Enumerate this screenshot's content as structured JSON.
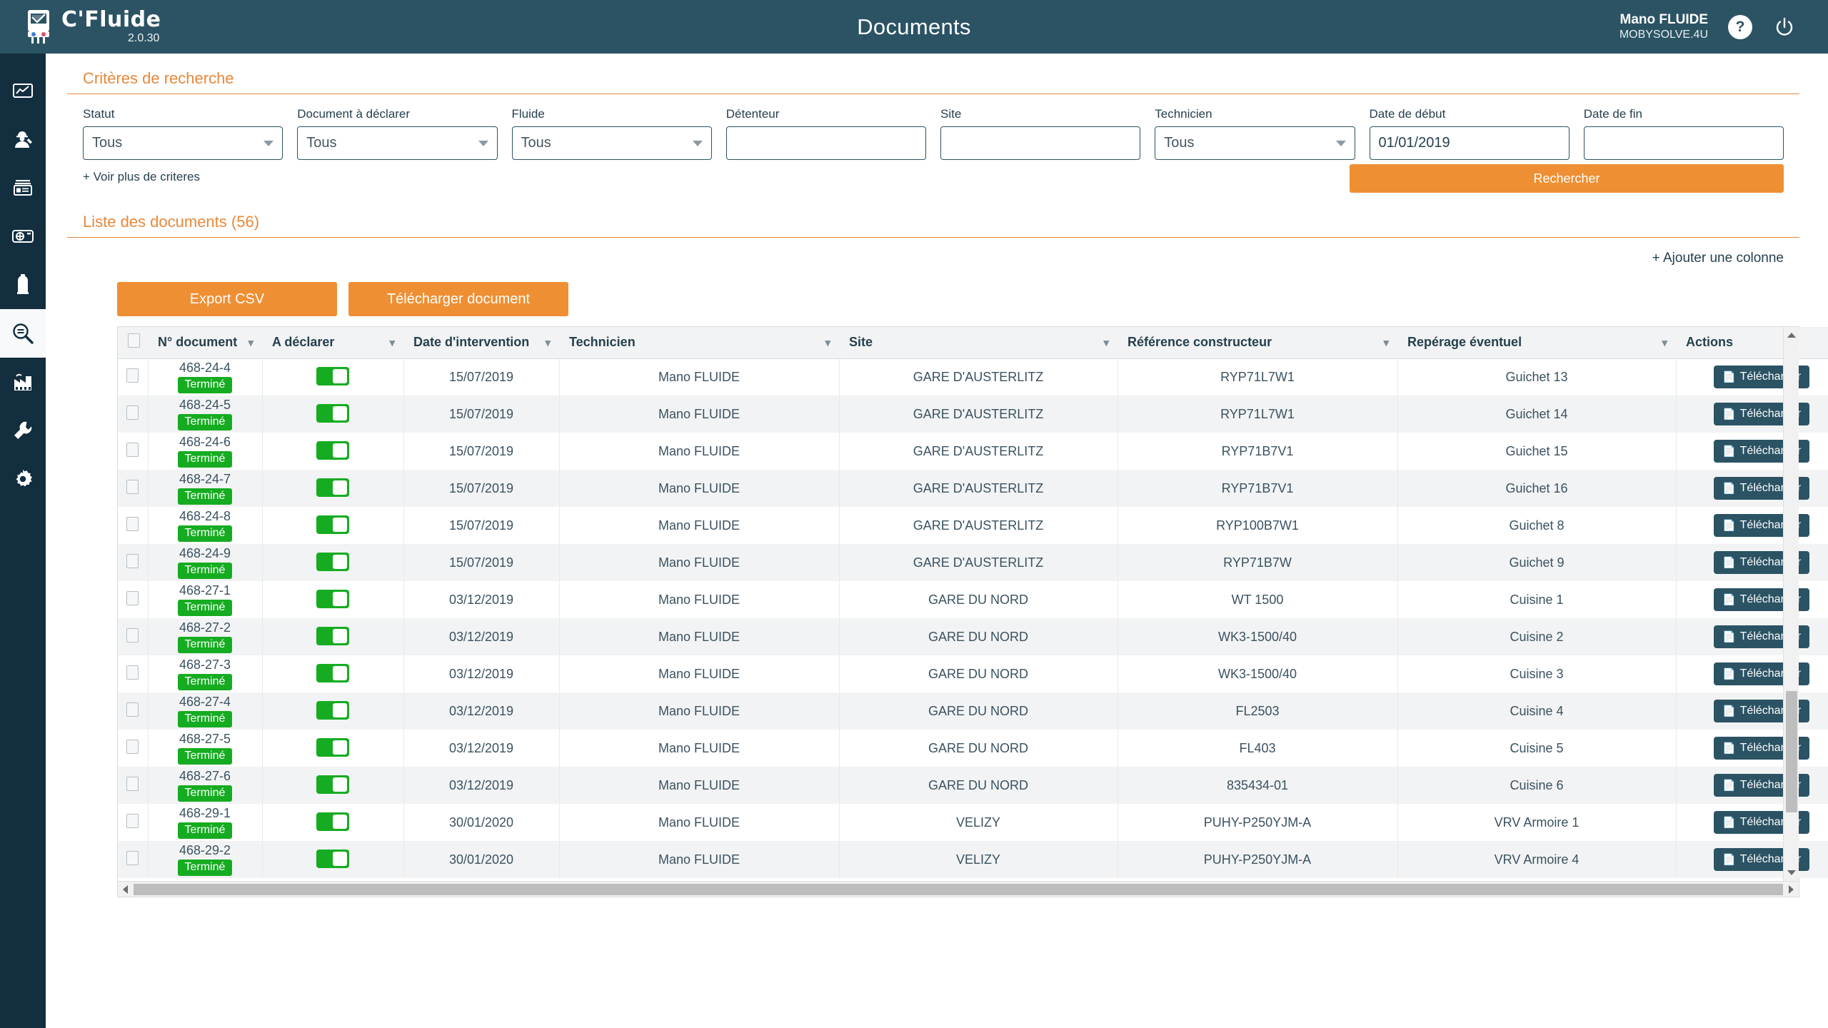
{
  "app": {
    "brand_name": "C'Fluide",
    "version": "2.0.30",
    "page_title": "Documents",
    "user_name": "Mano FLUIDE",
    "user_org": "MOBYSOLVE.4U",
    "help_label": "?"
  },
  "sidebar": {
    "items": [
      {
        "name": "dashboard-icon",
        "label": "Tableau de bord"
      },
      {
        "name": "technician-icon",
        "label": "Technicien"
      },
      {
        "name": "archive-card-icon",
        "label": "Fiches"
      },
      {
        "name": "equipment-icon",
        "label": "Equipements"
      },
      {
        "name": "gas-bottle-icon",
        "label": "Bouteilles"
      },
      {
        "name": "document-search-icon",
        "label": "Documents"
      },
      {
        "name": "factory-icon",
        "label": "Sites"
      },
      {
        "name": "wrench-icon",
        "label": "Interventions"
      },
      {
        "name": "gear-icon",
        "label": "Parametres"
      }
    ],
    "active_index": 5
  },
  "criteria": {
    "title": "Critères de recherche",
    "more_link": "+ Voir plus de criteres",
    "search_button": "Rechercher",
    "fields": [
      {
        "label": "Statut",
        "type": "select",
        "value": "Tous"
      },
      {
        "label": "Document à déclarer",
        "type": "select",
        "value": "Tous"
      },
      {
        "label": "Fluide",
        "type": "select",
        "value": "Tous"
      },
      {
        "label": "Détenteur",
        "type": "input",
        "value": ""
      },
      {
        "label": "Site",
        "type": "input",
        "value": ""
      },
      {
        "label": "Technicien",
        "type": "select",
        "value": "Tous"
      },
      {
        "label": "Date de début",
        "type": "input",
        "value": "01/01/2019"
      },
      {
        "label": "Date de fin",
        "type": "input",
        "value": ""
      }
    ]
  },
  "list": {
    "title": "Liste des documents (56)",
    "count": 56,
    "add_column": "+ Ajouter une colonne",
    "export_csv": "Export CSV",
    "download_document": "Télécharger document",
    "row_action_label": "Télécharger",
    "columns": [
      "N° document",
      "A déclarer",
      "Date d'intervention",
      "Technicien",
      "Site",
      "Référence constructeur",
      "Repérage éventuel",
      "Actions"
    ],
    "rows": [
      {
        "num": "468-24-4",
        "status": "Terminé",
        "declare": true,
        "date": "15/07/2019",
        "tech": "Mano FLUIDE",
        "site": "GARE D'AUSTERLITZ",
        "ref": "RYP71L7W1",
        "rep": "Guichet 13"
      },
      {
        "num": "468-24-5",
        "status": "Terminé",
        "declare": true,
        "date": "15/07/2019",
        "tech": "Mano FLUIDE",
        "site": "GARE D'AUSTERLITZ",
        "ref": "RYP71L7W1",
        "rep": "Guichet 14"
      },
      {
        "num": "468-24-6",
        "status": "Terminé",
        "declare": true,
        "date": "15/07/2019",
        "tech": "Mano FLUIDE",
        "site": "GARE D'AUSTERLITZ",
        "ref": "RYP71B7V1",
        "rep": "Guichet 15"
      },
      {
        "num": "468-24-7",
        "status": "Terminé",
        "declare": true,
        "date": "15/07/2019",
        "tech": "Mano FLUIDE",
        "site": "GARE D'AUSTERLITZ",
        "ref": "RYP71B7V1",
        "rep": "Guichet 16"
      },
      {
        "num": "468-24-8",
        "status": "Terminé",
        "declare": true,
        "date": "15/07/2019",
        "tech": "Mano FLUIDE",
        "site": "GARE D'AUSTERLITZ",
        "ref": "RYP100B7W1",
        "rep": "Guichet 8"
      },
      {
        "num": "468-24-9",
        "status": "Terminé",
        "declare": true,
        "date": "15/07/2019",
        "tech": "Mano FLUIDE",
        "site": "GARE D'AUSTERLITZ",
        "ref": "RYP71B7W",
        "rep": "Guichet 9"
      },
      {
        "num": "468-27-1",
        "status": "Terminé",
        "declare": true,
        "date": "03/12/2019",
        "tech": "Mano FLUIDE",
        "site": "GARE DU NORD",
        "ref": "WT 1500",
        "rep": "Cuisine 1"
      },
      {
        "num": "468-27-2",
        "status": "Terminé",
        "declare": true,
        "date": "03/12/2019",
        "tech": "Mano FLUIDE",
        "site": "GARE DU NORD",
        "ref": "WK3-1500/40",
        "rep": "Cuisine 2"
      },
      {
        "num": "468-27-3",
        "status": "Terminé",
        "declare": true,
        "date": "03/12/2019",
        "tech": "Mano FLUIDE",
        "site": "GARE DU NORD",
        "ref": "WK3-1500/40",
        "rep": "Cuisine 3"
      },
      {
        "num": "468-27-4",
        "status": "Terminé",
        "declare": true,
        "date": "03/12/2019",
        "tech": "Mano FLUIDE",
        "site": "GARE DU NORD",
        "ref": "FL2503",
        "rep": "Cuisine 4"
      },
      {
        "num": "468-27-5",
        "status": "Terminé",
        "declare": true,
        "date": "03/12/2019",
        "tech": "Mano FLUIDE",
        "site": "GARE DU NORD",
        "ref": "FL403",
        "rep": "Cuisine 5"
      },
      {
        "num": "468-27-6",
        "status": "Terminé",
        "declare": true,
        "date": "03/12/2019",
        "tech": "Mano FLUIDE",
        "site": "GARE DU NORD",
        "ref": "835434-01",
        "rep": "Cuisine 6"
      },
      {
        "num": "468-29-1",
        "status": "Terminé",
        "declare": true,
        "date": "30/01/2020",
        "tech": "Mano FLUIDE",
        "site": "VELIZY",
        "ref": "PUHY-P250YJM-A",
        "rep": "VRV Armoire 1"
      },
      {
        "num": "468-29-2",
        "status": "Terminé",
        "declare": true,
        "date": "30/01/2020",
        "tech": "Mano FLUIDE",
        "site": "VELIZY",
        "ref": "PUHY-P250YJM-A",
        "rep": "VRV Armoire 4"
      }
    ]
  },
  "colors": {
    "brand_dark": "#122e3f",
    "header_blue": "#2b5364",
    "accent_orange": "#ef8f33",
    "status_green": "#16ac21"
  }
}
